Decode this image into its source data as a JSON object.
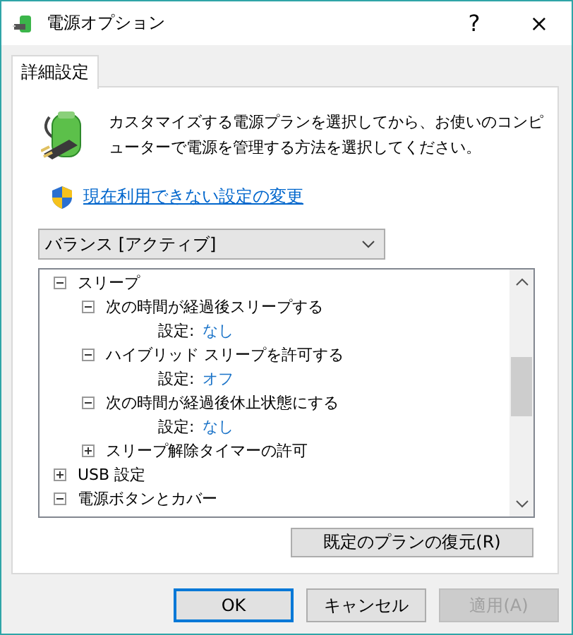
{
  "window": {
    "title": "電源オプション",
    "help": "?",
    "close": "×"
  },
  "tabs": [
    {
      "label": "詳細設定",
      "selected": true
    }
  ],
  "description": "カスタマイズする電源プランを選択してから、お使いのコンピューターで電源を管理する方法を選択してください。",
  "link": "現在利用できない設定の変更",
  "plan_dropdown": {
    "value": "バランス [アクティブ]"
  },
  "tree": [
    {
      "kind": "group",
      "label": "スリープ",
      "expanded": true,
      "children": [
        {
          "kind": "group",
          "label": "次の時間が経過後スリープする",
          "expanded": true,
          "children": [
            {
              "kind": "setting",
              "label": "設定:",
              "value": "なし"
            }
          ]
        },
        {
          "kind": "group",
          "label": "ハイブリッド スリープを許可する",
          "expanded": true,
          "children": [
            {
              "kind": "setting",
              "label": "設定:",
              "value": "オフ"
            }
          ]
        },
        {
          "kind": "group",
          "label": "次の時間が経過後休止状態にする",
          "expanded": true,
          "children": [
            {
              "kind": "setting",
              "label": "設定:",
              "value": "なし"
            }
          ]
        },
        {
          "kind": "group",
          "label": "スリープ解除タイマーの許可",
          "expanded": false
        }
      ]
    },
    {
      "kind": "group",
      "label": "USB 設定",
      "expanded": false
    },
    {
      "kind": "group",
      "label": "電源ボタンとカバー",
      "expanded": true
    }
  ],
  "restore_button": "既定のプランの復元(R)",
  "buttons": [
    {
      "label": "OK",
      "default": true,
      "disabled": false
    },
    {
      "label": "キャンセル",
      "default": false,
      "disabled": false
    },
    {
      "label": "適用(A)",
      "default": false,
      "disabled": true
    }
  ]
}
